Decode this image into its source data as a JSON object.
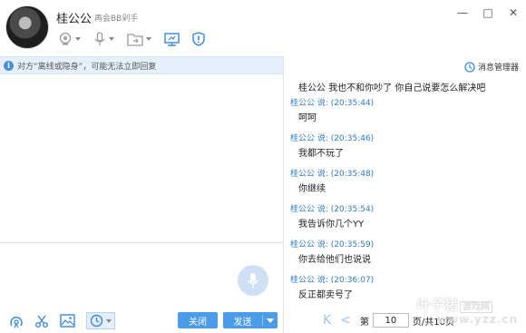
{
  "contact": {
    "name": "桂公公",
    "signature": "再会BB剁手"
  },
  "window_controls": {
    "minimize": "—",
    "maximize": "□",
    "close": "✕"
  },
  "notice": {
    "icon": "i",
    "text": "对方“离线或隐身”，可能无法立即回复"
  },
  "input": {
    "close_label": "关闭",
    "send_label": "发送"
  },
  "history": {
    "manager_label": "消息管理器",
    "first_line": "桂公公  我也不和你吵了  你自己说要怎么解决吧",
    "messages": [
      {
        "meta": "桂公公 说: (20:35:44)",
        "text": "呵呵"
      },
      {
        "meta": "桂公公 说: (20:35:46)",
        "text": "我都不玩了"
      },
      {
        "meta": "桂公公 说: (20:35:48)",
        "text": "你继续"
      },
      {
        "meta": "桂公公 说: (20:35:54)",
        "text": "我告诉你几个YY"
      },
      {
        "meta": "桂公公 说: (20:35:59)",
        "text": "你去给他们也说说"
      },
      {
        "meta": "桂公公 说: (20:36:07)",
        "text": "反正都卖号了"
      }
    ],
    "pager": {
      "first": "K",
      "prev": "<",
      "label_before": "第",
      "page": "10",
      "label_after": "页/共10页"
    }
  },
  "watermark": {
    "brand": "叶子猪",
    "tag": "游戏网",
    "url": "www.yzz.cn"
  },
  "colors": {
    "accent": "#4a9be8",
    "link_blue": "#2f7ac2",
    "notice_bg": "#e6f0fb"
  }
}
